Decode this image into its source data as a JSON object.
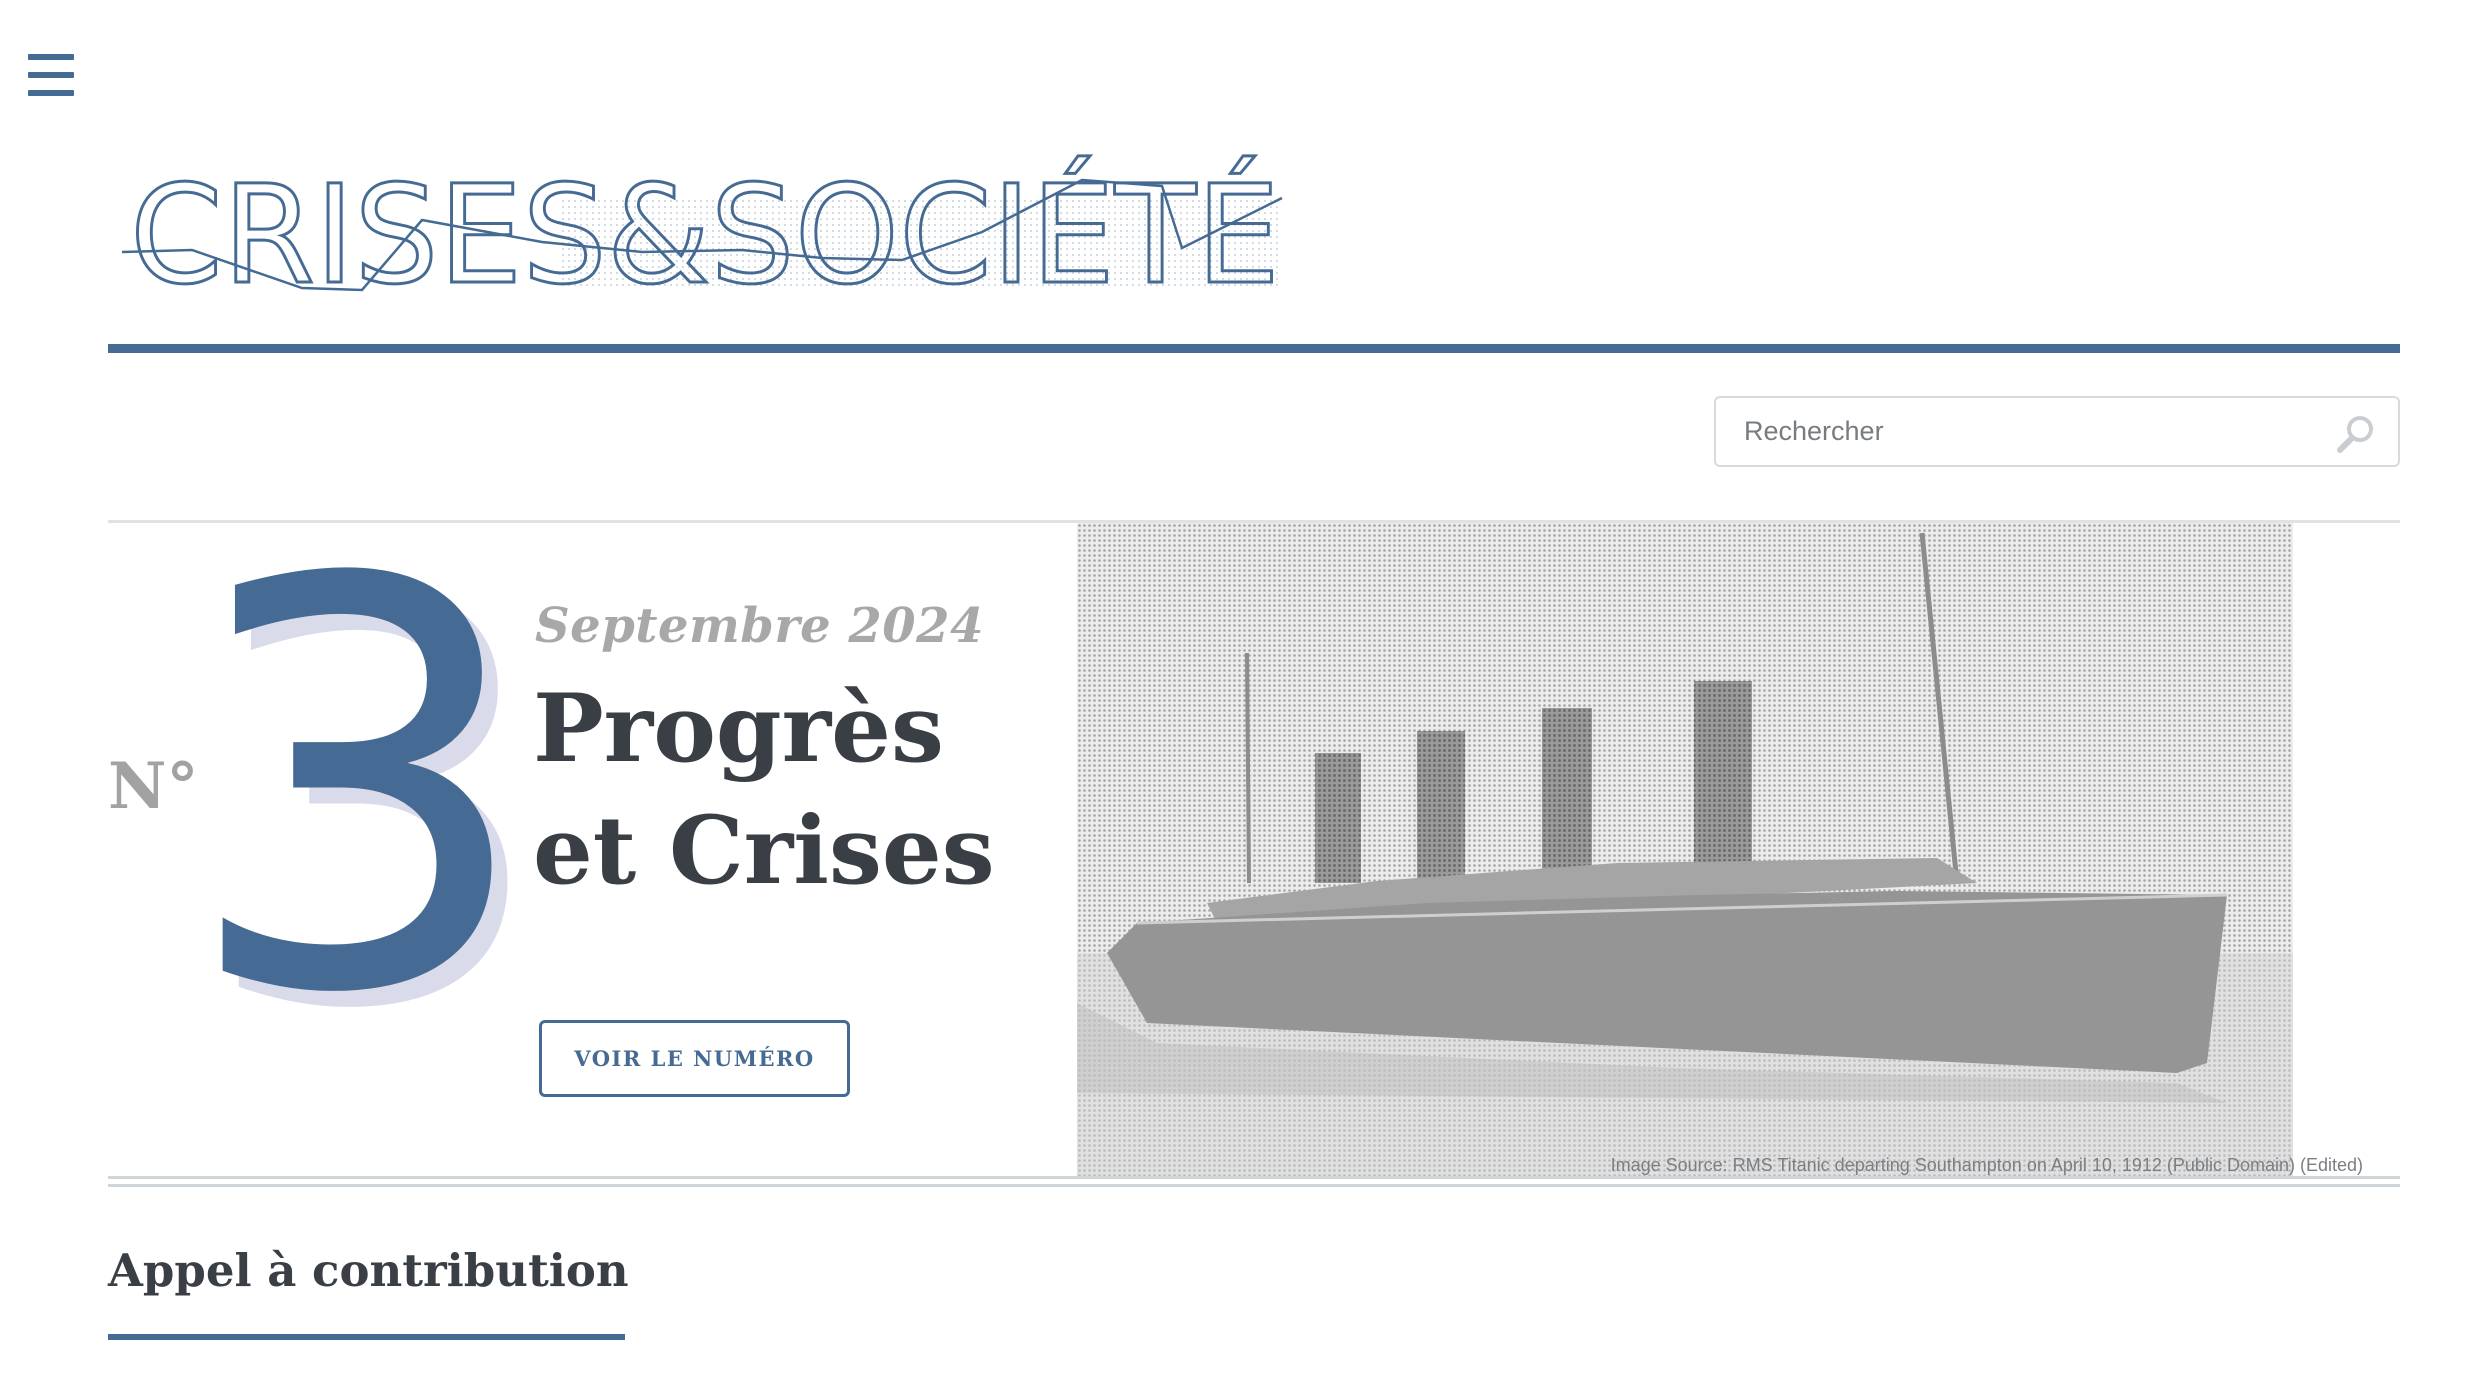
{
  "header": {
    "menu_icon": "hamburger-menu-icon",
    "logo_text": "CRISES&SOCIÉTÉ",
    "brand_color": "#456a93"
  },
  "search": {
    "placeholder": "Rechercher",
    "value": "",
    "icon": "search-icon"
  },
  "hero": {
    "numero_label": "N°",
    "numero": "3",
    "date": "Septembre 2024",
    "title_line1": "Progrès",
    "title_line2": "et Crises",
    "button_label": "VOIR LE NUMÉRO",
    "image_caption": "Image Source: RMS Titanic departing Southampton on April 10, 1912 (Public Domain) (Edited)"
  },
  "section": {
    "title": "Appel à contribution"
  }
}
